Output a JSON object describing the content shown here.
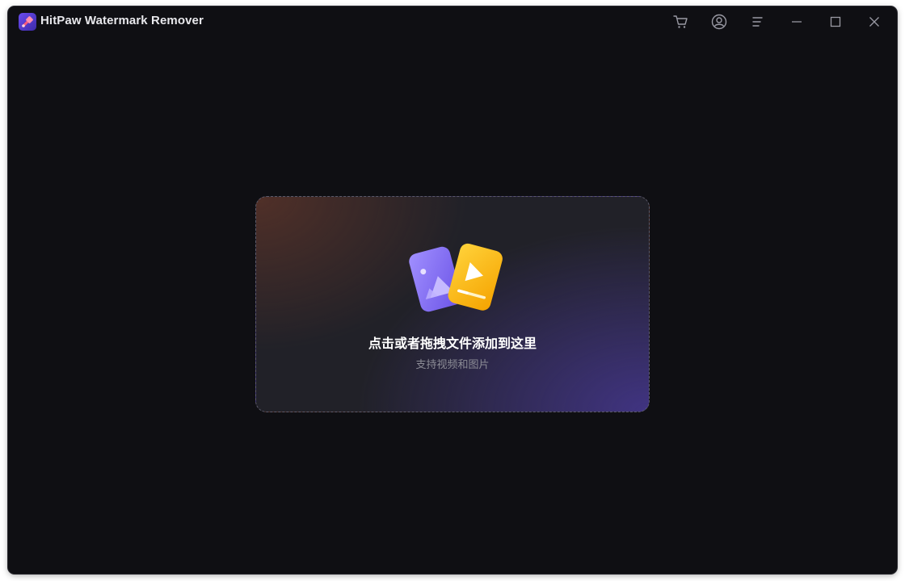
{
  "window": {
    "title": "HitPaw Watermark Remover",
    "background": "#0f0f13"
  },
  "titlebar": {
    "icons": [
      "cart-icon",
      "account-icon",
      "menu-icon",
      "minimize-icon",
      "maximize-icon",
      "close-icon"
    ]
  },
  "dropzone": {
    "title": "点击或者拖拽文件添加到这里",
    "subtitle": "支持视频和图片",
    "icon": "image-video-files-icon",
    "colors": {
      "image_card": "#8a73f2",
      "video_card": "#f7b500",
      "border": "#5c5a6a"
    }
  }
}
